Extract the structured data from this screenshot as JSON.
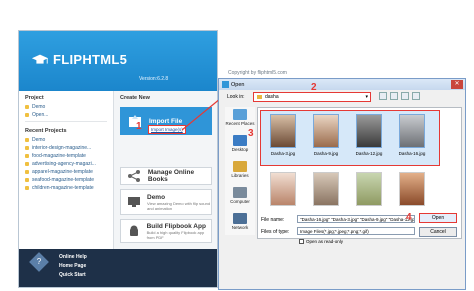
{
  "app": {
    "brand": "FLIPHTML5",
    "version": "Version:6.2.8",
    "copyright": "Copyright by fliphtml5.com",
    "project_title": "Project",
    "project_items": [
      "Demo",
      "Open..."
    ],
    "recent_title": "Recent Projects",
    "recent_items": [
      "Demo",
      "interior-design-magazine...",
      "food-magazine-template",
      "advertising-agency-magazi...",
      "apparel-magazine-template",
      "seafood-magazine-template",
      "children-magazine-template"
    ],
    "create_title": "Create New",
    "import_label": "Import File",
    "import_link": "Import Image(s)",
    "manage_label": "Manage Online Books",
    "demo_label": "Demo",
    "demo_sub": "View amazing Demo with flip sound and animation",
    "build_label": "Build Flipbook App",
    "build_sub": "Build a high quality Flipbook app from PDF",
    "footer_links": [
      "Online Help",
      "Home Page",
      "Quick Start"
    ]
  },
  "dialog": {
    "title": "Open",
    "close": "✕",
    "look_in_label": "Look in:",
    "look_in_value": "dasha",
    "places": [
      "Recent Places",
      "Desktop",
      "Libraries",
      "Computer",
      "Network"
    ],
    "files": [
      "Dasha-3.jpg",
      "Dasha-9.jpg",
      "Dasha-12.jpg",
      "Dasha-16.jpg"
    ],
    "file_name_label": "File name:",
    "file_name_value": "\"Dasha-16.jpg\" \"Dasha-3.jpg\" \"Dasha-9.jpg\" \"Dasha-12.jpg\"",
    "file_type_label": "Files of type:",
    "file_type_value": "Image Files(*.jpg;*.jpeg;*.png;*.gif)",
    "read_only_label": "Open as read-only",
    "open_button": "Open",
    "cancel_button": "Cancel"
  },
  "annotations": [
    "1",
    "2",
    "3",
    "4"
  ],
  "colors": {
    "accent": "#2f95d8",
    "highlight": "#e53935",
    "footer": "#1e3048"
  }
}
